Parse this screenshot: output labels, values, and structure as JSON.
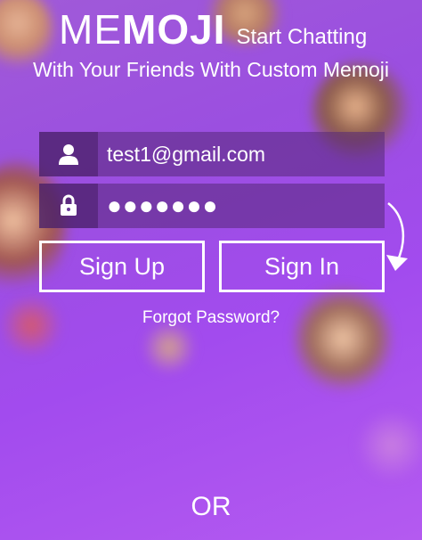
{
  "header": {
    "logo_me": "ME",
    "logo_moji": "MOJI",
    "tagline_inline": "Start Chatting",
    "tagline_rest": "With Your Friends With Custom Memoji"
  },
  "login": {
    "email_value": "test1@gmail.com",
    "password_masked": "●●●●●●●",
    "email_icon": "user-icon",
    "password_icon": "lock-icon"
  },
  "actions": {
    "sign_up_label": "Sign Up",
    "sign_in_label": "Sign In",
    "forgot_password_label": "Forgot Password?",
    "or_label": "OR"
  },
  "colors": {
    "background_top": "#a05ad8",
    "background_bottom": "#b45af0",
    "field_bg": "#55287a",
    "text": "#ffffff"
  }
}
